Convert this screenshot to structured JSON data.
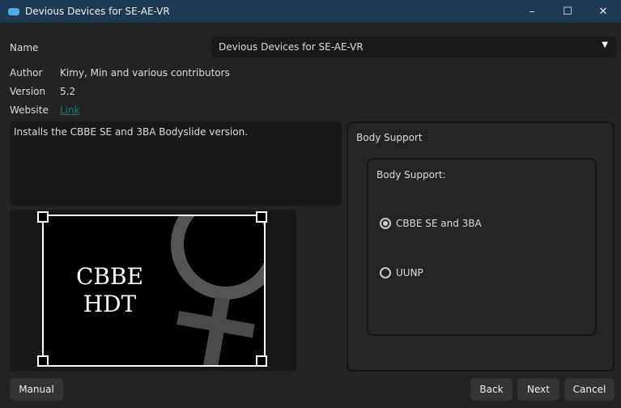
{
  "window": {
    "title": "Devious Devices for SE-AE-VR",
    "minimize": "–",
    "maximize": "☐",
    "close": "✕"
  },
  "info": {
    "name_label": "Name",
    "name_value": "Devious Devices for SE-AE-VR",
    "author_label": "Author",
    "author_value": "Kimy, Min and various contributors",
    "version_label": "Version",
    "version_value": "5.2",
    "website_label": "Website",
    "website_value": "Link"
  },
  "description": "Installs the CBBE SE and 3BA Bodyslide version.",
  "image": {
    "text_line1": "CBBE",
    "text_line2": "HDT"
  },
  "group": {
    "title": "Body Support",
    "inner_title": "Body Support:",
    "options": [
      {
        "label": "CBBE SE and 3BA",
        "selected": true
      },
      {
        "label": "UUNP",
        "selected": false
      }
    ]
  },
  "buttons": {
    "manual": "Manual",
    "back": "Back",
    "next": "Next",
    "cancel": "Cancel"
  }
}
